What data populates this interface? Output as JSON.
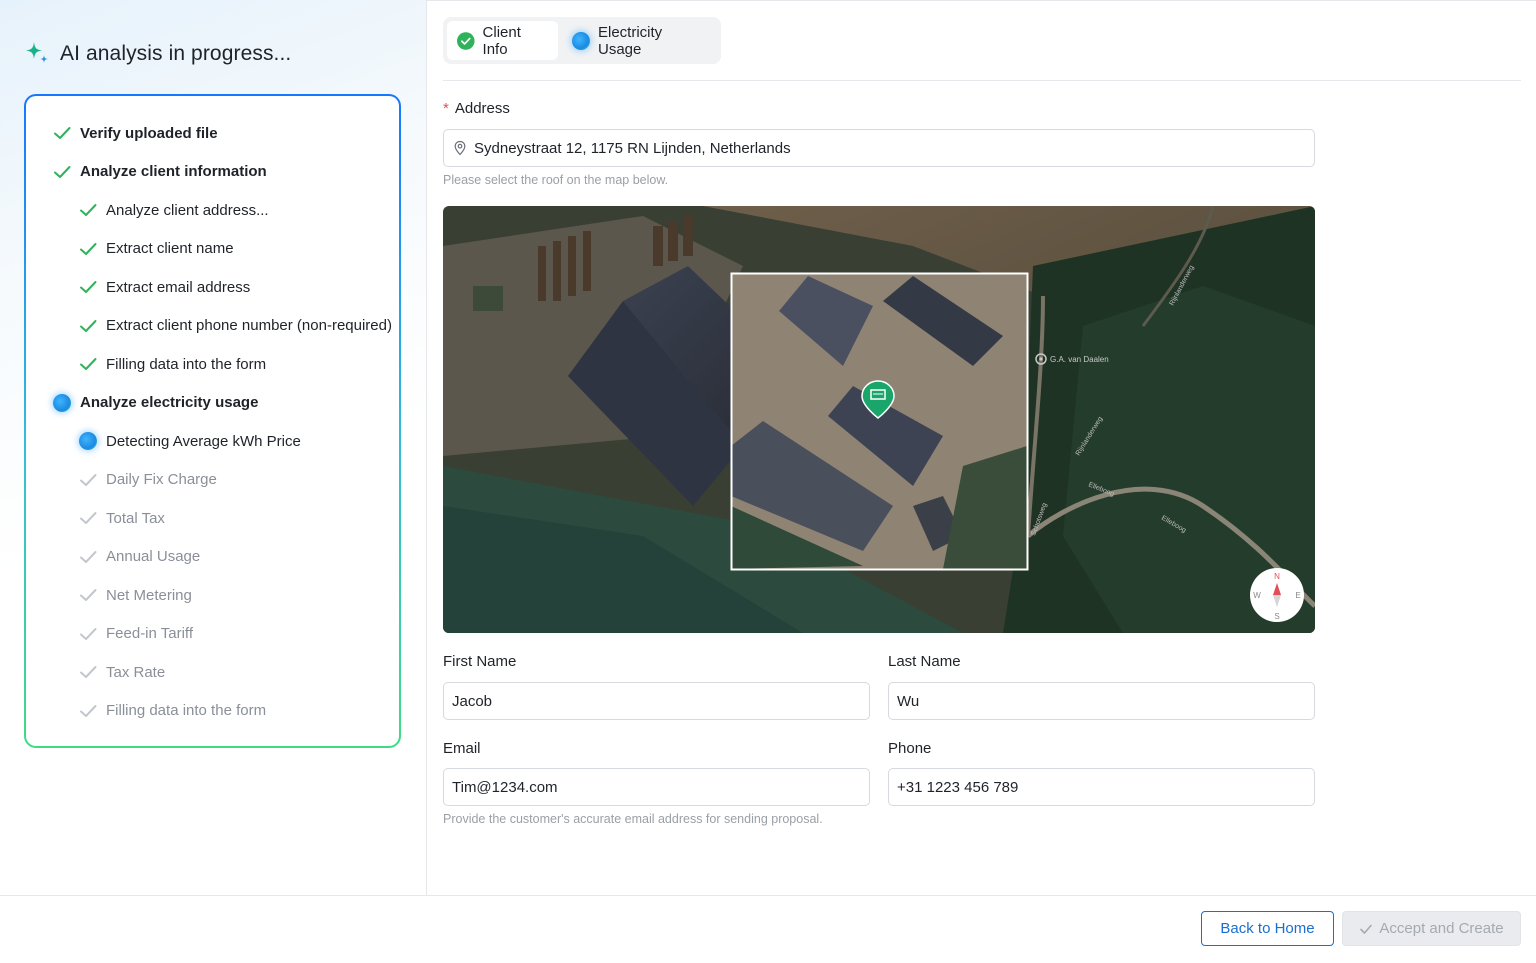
{
  "analysis": {
    "title": "AI analysis in progress...",
    "steps": [
      {
        "label": "Verify uploaded file",
        "state": "done",
        "level": 0
      },
      {
        "label": "Analyze client information",
        "state": "done",
        "level": 0
      },
      {
        "label": "Analyze client address...",
        "state": "done",
        "level": 1
      },
      {
        "label": "Extract client name",
        "state": "done",
        "level": 1
      },
      {
        "label": "Extract email address",
        "state": "done",
        "level": 1
      },
      {
        "label": "Extract client phone number (non-required)",
        "state": "done",
        "level": 1
      },
      {
        "label": "Filling data into the form",
        "state": "done",
        "level": 1
      },
      {
        "label": "Analyze electricity usage",
        "state": "active",
        "level": 0
      },
      {
        "label": "Detecting Average kWh Price",
        "state": "active",
        "level": 1
      },
      {
        "label": "Daily Fix Charge",
        "state": "pending",
        "level": 1
      },
      {
        "label": "Total Tax",
        "state": "pending",
        "level": 1
      },
      {
        "label": "Annual Usage",
        "state": "pending",
        "level": 1
      },
      {
        "label": "Net Metering",
        "state": "pending",
        "level": 1
      },
      {
        "label": "Feed-in Tariff",
        "state": "pending",
        "level": 1
      },
      {
        "label": "Tax Rate",
        "state": "pending",
        "level": 1
      },
      {
        "label": "Filling data into the form",
        "state": "pending",
        "level": 1
      }
    ]
  },
  "tabs": [
    {
      "label": "Client Info",
      "status": "done",
      "active": true
    },
    {
      "label": "Electricity Usage",
      "status": "in-progress",
      "active": false
    }
  ],
  "form": {
    "address": {
      "label": "Address",
      "required_mark": "*",
      "value": "Sydneystraat 12, 1175 RN Lijnden, Netherlands",
      "hint": "Please select the roof on the map below.",
      "icon": "location-pin-icon"
    },
    "map": {
      "place_label": "G.A. van Daalen",
      "road_labels": [
        "Rijnlanderweg",
        "Rijnlanderweg",
        "Elleboog",
        "Elleboog",
        "Schotsweg"
      ],
      "compass": {
        "n": "N",
        "s": "S",
        "e": "E",
        "w": "W"
      }
    },
    "first_name": {
      "label": "First Name",
      "value": "Jacob"
    },
    "last_name": {
      "label": "Last Name",
      "value": "Wu"
    },
    "email": {
      "label": "Email",
      "value": "Tim@1234.com",
      "hint": "Provide the customer's accurate email address for sending  proposal."
    },
    "phone": {
      "label": "Phone",
      "value": "+31 1223 456 789"
    }
  },
  "footer": {
    "back_label": "Back to Home",
    "accept_label": "Accept and Create"
  },
  "colors": {
    "success": "#2fb35a",
    "primary": "#1a6fd0",
    "required": "#e34d59"
  }
}
